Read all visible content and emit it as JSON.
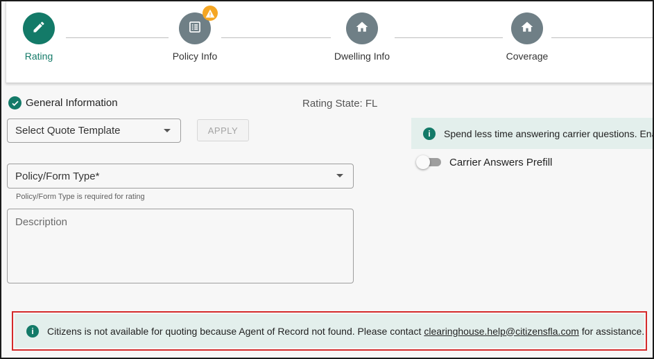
{
  "stepper": {
    "steps": [
      {
        "label": "Rating",
        "icon": "pencil-icon",
        "active": true
      },
      {
        "label": "Policy Info",
        "icon": "list-icon",
        "warning": true
      },
      {
        "label": "Dwelling Info",
        "icon": "home-icon"
      },
      {
        "label": "Coverage",
        "icon": "home-icon"
      }
    ]
  },
  "general": {
    "title": "General Information",
    "rating_state": "Rating State: FL"
  },
  "quote_template": {
    "placeholder": "Select Quote Template",
    "apply_label": "APPLY"
  },
  "policy_form": {
    "label": "Policy/Form Type*",
    "helper": "Policy/Form Type is required for rating"
  },
  "description": {
    "placeholder": "Description"
  },
  "carrier_banner": {
    "text": "Spend less time answering carrier questions. Enab"
  },
  "carrier_prefill": {
    "label": "Carrier Answers Prefill",
    "enabled": false
  },
  "alert": {
    "text_before": "Citizens is not available for quoting because Agent of Record not found. Please contact",
    "email": "clearinghouse.help@citizensfla.com",
    "text_after": "for assistance."
  },
  "colors": {
    "accent": "#137a68",
    "inactive_step": "#6f7f86",
    "warning": "#f5a623",
    "alert_border": "#d42a2a",
    "info_bg": "#e3efec"
  }
}
